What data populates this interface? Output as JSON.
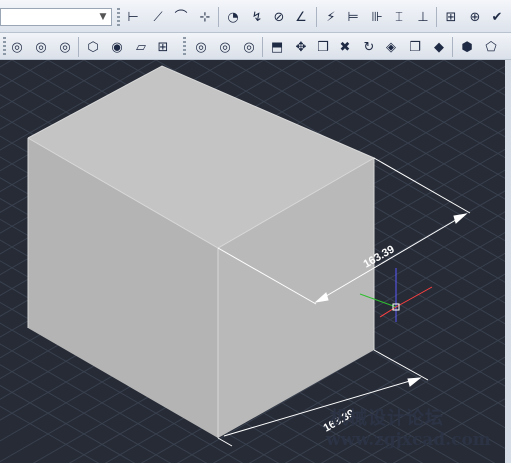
{
  "toolbar_top": {
    "layer_combo_value": "",
    "buttons": [
      {
        "icon": "linear-dimension-icon",
        "glyph": "⊢"
      },
      {
        "icon": "aligned-dimension-icon",
        "glyph": "⟋"
      },
      {
        "icon": "arc-length-icon",
        "glyph": "⌒"
      },
      {
        "icon": "ordinate-dimension-icon",
        "glyph": "⊹"
      },
      {
        "icon": "radius-dimension-icon",
        "glyph": "◔"
      },
      {
        "icon": "jogged-dimension-icon",
        "glyph": "↯"
      },
      {
        "icon": "diameter-dimension-icon",
        "glyph": "⊘"
      },
      {
        "icon": "angular-dimension-icon",
        "glyph": "∠"
      },
      {
        "icon": "quick-dimension-icon",
        "glyph": "⚡"
      },
      {
        "icon": "baseline-dimension-icon",
        "glyph": "⊨"
      },
      {
        "icon": "continue-dimension-icon",
        "glyph": "⊪"
      },
      {
        "icon": "dimension-space-icon",
        "glyph": "⌶"
      },
      {
        "icon": "dimension-break-icon",
        "glyph": "⊥"
      },
      {
        "icon": "tolerance-icon",
        "glyph": "⊞"
      },
      {
        "icon": "center-mark-icon",
        "glyph": "⊕"
      },
      {
        "icon": "inspect-icon",
        "glyph": "✔"
      }
    ]
  },
  "toolbar_second": {
    "buttons": [
      {
        "icon": "union-icon",
        "glyph": "◎"
      },
      {
        "icon": "subtract-icon",
        "glyph": "◎"
      },
      {
        "icon": "intersect-icon",
        "glyph": "◎"
      },
      {
        "icon": "box-view-icon",
        "glyph": "⬡"
      },
      {
        "icon": "orbit-icon",
        "glyph": "◉"
      },
      {
        "icon": "section-icon",
        "glyph": "▱"
      },
      {
        "icon": "grid-icon",
        "glyph": "⊞"
      },
      {
        "icon": "union-2-icon",
        "glyph": "◎"
      },
      {
        "icon": "subtract-2-icon",
        "glyph": "◎"
      },
      {
        "icon": "intersect-2-icon",
        "glyph": "◎"
      },
      {
        "icon": "extrude-faces-icon",
        "glyph": "⬒"
      },
      {
        "icon": "move-faces-icon",
        "glyph": "✥"
      },
      {
        "icon": "offset-faces-icon",
        "glyph": "❒"
      },
      {
        "icon": "delete-faces-icon",
        "glyph": "✖"
      },
      {
        "icon": "rotate-faces-icon",
        "glyph": "↻"
      },
      {
        "icon": "taper-faces-icon",
        "glyph": "◈"
      },
      {
        "icon": "copy-faces-icon",
        "glyph": "❐"
      },
      {
        "icon": "color-faces-icon",
        "glyph": "◆"
      },
      {
        "icon": "imprint-icon",
        "glyph": "⬢"
      },
      {
        "icon": "shell-icon",
        "glyph": "⬠"
      }
    ]
  },
  "drawing": {
    "dimension_top": "163.39",
    "dimension_bottom": "163.39",
    "background_color": "#262b36",
    "cube_top_color": "#c4c4c4",
    "cube_left_color": "#b4b4b4",
    "cube_right_color": "#b9b9b9"
  },
  "watermark": {
    "site_name": "机械设计论坛",
    "url": "www.zgjxcad.com"
  }
}
